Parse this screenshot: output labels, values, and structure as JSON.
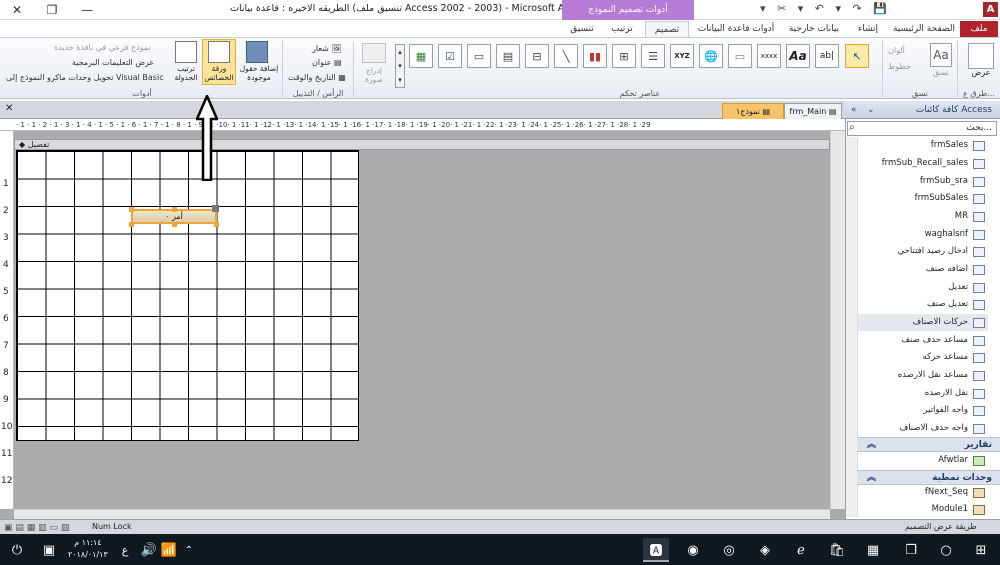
{
  "window": {
    "title": "الطريقه الاخيره : قاعدة بيانات (تنسيق ملف Access 2002 - 2003) - Microsoft Access",
    "context_tab": "أدوات تصميم النموذج",
    "close": "✕",
    "restore": "❐",
    "minimize": "—"
  },
  "ribbon_tabs": [
    "ملف",
    "الصفحة الرئيسية",
    "إنشاء",
    "بيانات خارجية",
    "أدوات قاعدة البيانات",
    "تصميم",
    "ترتيب",
    "تنسيق"
  ],
  "groups": {
    "views": "طرق ع...",
    "themes": "نسق",
    "controls": "عناصر تحكم",
    "header_footer": "الرأس / التذييل",
    "tools": "أدوات"
  },
  "buttons": {
    "view": "عرض",
    "themes": "نسق",
    "colors": "ألوان",
    "fonts": "خطوط",
    "insert_image": "إدراج صورة",
    "logo": "شعار",
    "title": "عنوان",
    "date_time": "التاريخ والوقت",
    "add_fields": "إضافة حقول موجودة",
    "property_sheet": "ورقة الخصائص",
    "tab_order": "ترتيب الجدولة",
    "subform_new_window": "نموذج فرعي في نافذة جديدة",
    "view_code": "عرض التعليمات البرمجية",
    "convert_macros": "تحويل وحدات ماكرو النموذج إلى Visual Basic",
    "aa": "Aa",
    "ab": "ab|",
    "xyz": "XYZ",
    "xxxx": "xxxx"
  },
  "doc_tabs": [
    "frm_Main",
    "نموذج١"
  ],
  "section_header": "تفصيل",
  "command_button": "أمر ٠",
  "ruler_text": "· 1 · 1 · 2 · 1 · 3 · 1 · 4 · 1 · 5 · 1 · 6 · 1 · 7 · 1 · 8 · 1 · 9 · 1 ·10· 1 ·11· 1 ·12· 1 ·13· 1 ·14· 1 ·15· 1 ·16· 1 ·17· 1 ·18· 1 ·19· 1 ·20· 1 ·21· 1 ·22· 1 ·23· 1 ·24· 1 ·25· 1 ·26· 1 ·27· 1 ·28· 1 ·29",
  "vruler": [
    "1",
    "2",
    "3",
    "4",
    "5",
    "6",
    "7",
    "8",
    "9",
    "10",
    "11",
    "12"
  ],
  "nav": {
    "title": "كافة كائنات Access",
    "search_placeholder": "بحث...",
    "forms": [
      "frmSales",
      "frmSub_Recall_sales",
      "frmSub_sra",
      "frmSubSales",
      "MR",
      "waghalsnf",
      "ادخال رصيد افتتاحي",
      "اضافه صنف",
      "تعديل",
      "تعديل صنف",
      "حركات الاصناف",
      "مساعد حذف صنف",
      "مساعد حركه",
      "مساعد نقل الارصده",
      "نقل الارصده",
      "واجه الفواتير",
      "واجه حذف الاصناف"
    ],
    "reports_header": "تقارير",
    "reports": [
      "Afwtlar"
    ],
    "modules_header": "وحدات نمطية",
    "modules": [
      "fNext_Seq",
      "Module1"
    ]
  },
  "status": {
    "left": "Num Lock",
    "right": "طريقة عرض التصميم"
  },
  "taskbar": {
    "time": "١١:١٤ م",
    "date": "٢٠١٨/٠١/١٣",
    "lang": "ع"
  }
}
